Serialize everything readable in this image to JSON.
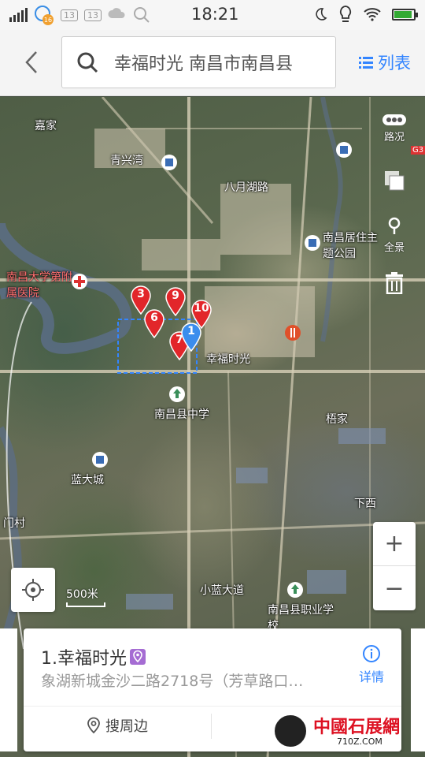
{
  "status_bar": {
    "time": "18:21",
    "notification_count": "16",
    "sim1": "13",
    "sim2": "13"
  },
  "header": {
    "search_text": "幸福时光 南昌市南昌县",
    "list_label": "列表"
  },
  "map": {
    "tools": {
      "traffic": "路况",
      "panorama": "全景"
    },
    "scale": "500米",
    "labels": [
      {
        "text": "嘉家"
      },
      {
        "text": "青兴湾"
      },
      {
        "text": "八月湖路"
      },
      {
        "text": "南昌居住主题公园"
      },
      {
        "text": "南昌大学第附属医院",
        "red": true
      },
      {
        "text": "幸福时光"
      },
      {
        "text": "南昌县中学"
      },
      {
        "text": "梧家"
      },
      {
        "text": "下西"
      },
      {
        "text": "小蓝大道"
      },
      {
        "text": "南昌县职业学校"
      },
      {
        "text": "门村"
      },
      {
        "text": "蓝大城"
      },
      {
        "text": "G3"
      }
    ],
    "markers": [
      {
        "label": "3",
        "color": "#e2262a"
      },
      {
        "label": "9",
        "color": "#e2262a"
      },
      {
        "label": "10",
        "color": "#e2262a"
      },
      {
        "label": "6",
        "color": "#e2262a"
      },
      {
        "label": "7",
        "color": "#e2262a"
      },
      {
        "label": "1",
        "color": "#3b8ded"
      }
    ]
  },
  "card": {
    "title": "1.幸福时光",
    "address": "象湖新城金沙二路2718号（芳草路口…",
    "detail_label": "详情",
    "nearby_label": "搜周边"
  },
  "watermark": {
    "text": "中國石展網",
    "url": "710Z.COM"
  }
}
